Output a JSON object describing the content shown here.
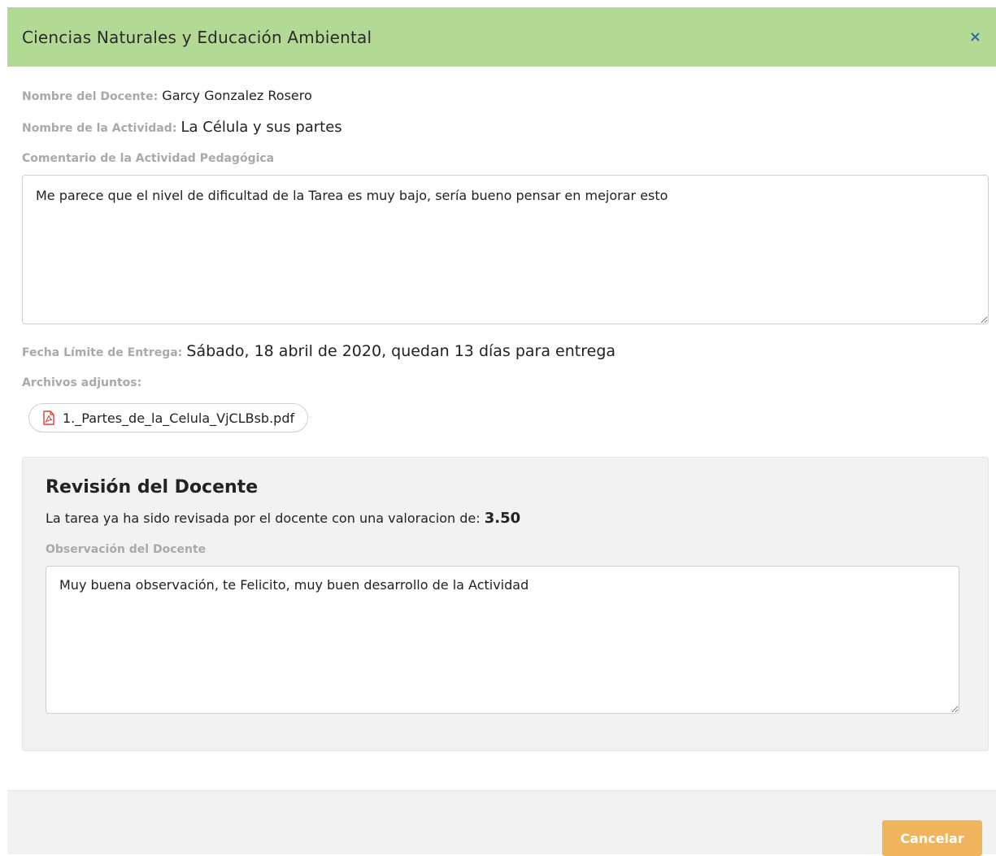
{
  "modal": {
    "title": "Ciencias Naturales y Educación Ambiental",
    "close_label": "×"
  },
  "info": {
    "teacher_label": "Nombre del Docente:",
    "teacher_value": "Garcy Gonzalez Rosero",
    "activity_label": "Nombre de la Actividad:",
    "activity_value": "La Célula y sus partes",
    "comment_label": "Comentario de la Actividad Pedagógica",
    "comment_value": "Me parece que el nivel de dificultad de la Tarea es muy bajo, sería bueno pensar en mejorar esto",
    "deadline_label": "Fecha Límite de Entrega:",
    "deadline_value": "Sábado, 18 abril de 2020, quedan 13 días para entrega",
    "attachments_label": "Archivos adjuntos:",
    "attachments": [
      {
        "name": "1._Partes_de_la_Celula_VjCLBsb.pdf",
        "icon": "pdf-file-icon"
      }
    ]
  },
  "review": {
    "title": "Revisión del Docente",
    "status_text": "La tarea ya ha sido revisada por el docente con una valoracion de:",
    "score": "3.50",
    "observation_label": "Observación del Docente",
    "observation_value": "Muy buena observación, te Felicito, muy buen desarrollo de la Actividad"
  },
  "footer": {
    "cancel_label": "Cancelar"
  },
  "colors": {
    "header_bg": "#b3da95",
    "close_icon": "#2e69b3",
    "cancel_bg": "#f0b55c",
    "label": "#a9a9a9",
    "pdf_icon": "#e0403a"
  }
}
